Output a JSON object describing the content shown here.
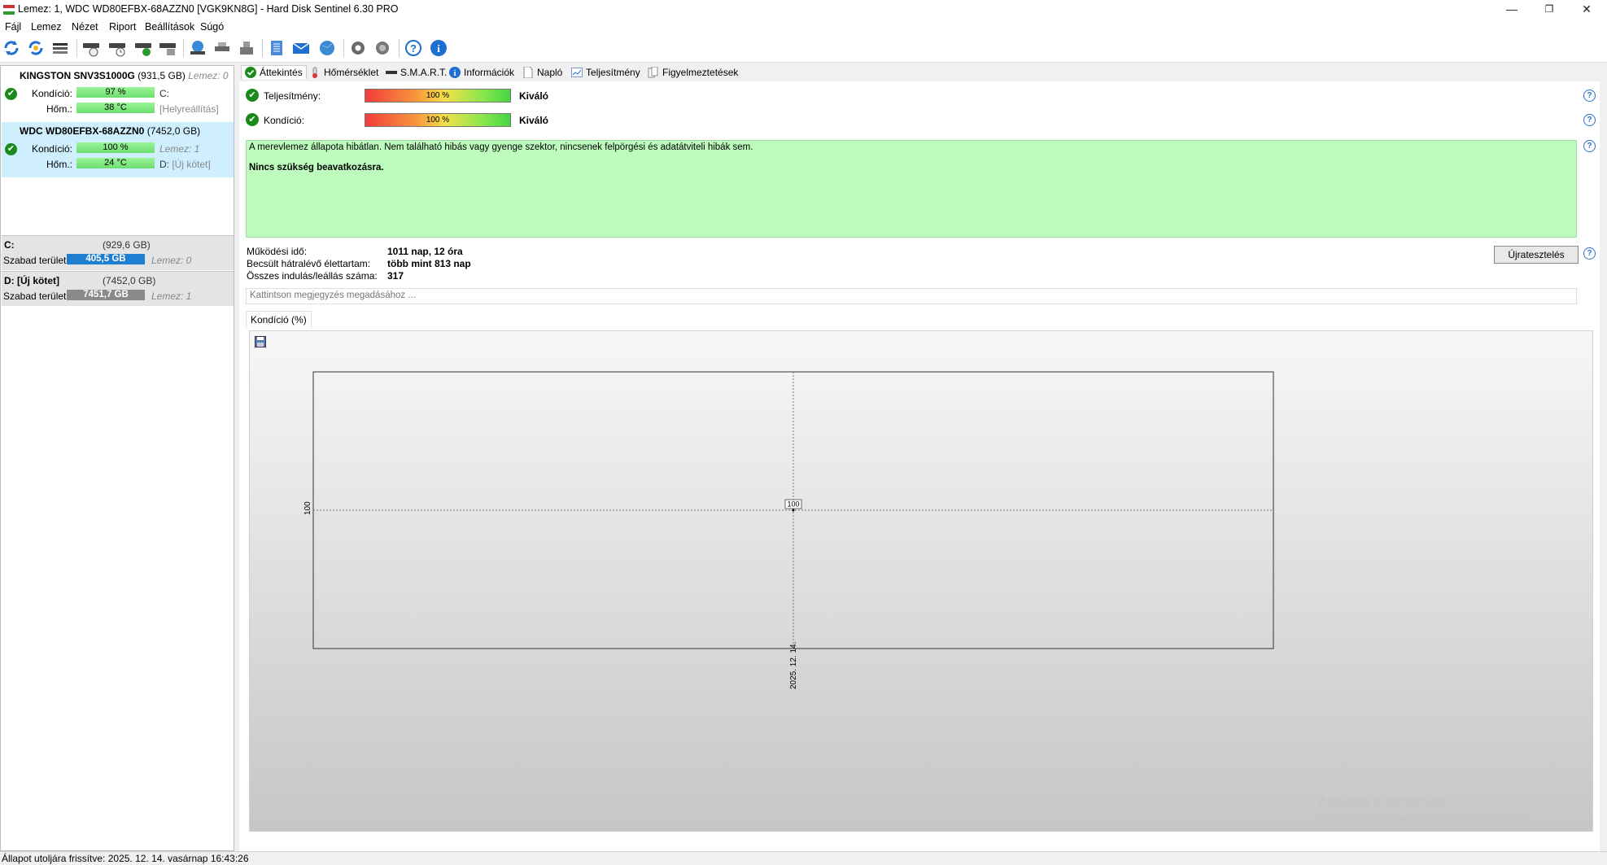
{
  "window": {
    "title": "Lemez: 1, WDC WD80EFBX-68AZZN0 [VGK9KN8G]  -  Hard Disk Sentinel 6.30 PRO",
    "minimize": "—",
    "maximize": "❐",
    "close": "✕"
  },
  "menu": [
    "Fájl",
    "Lemez",
    "Nézet",
    "Riport",
    "Beállítások",
    "Súgó"
  ],
  "disks": [
    {
      "name": "KINGSTON SNV3S1000G",
      "size": "(931,5 GB)",
      "disk_num": "Lemez: 0",
      "health_label": "Kondíció:",
      "health": "97 %",
      "health_extra": "C:",
      "temp_label": "Hőm.:",
      "temp": "38 °C",
      "temp_extra": "[Helyreállítás]"
    },
    {
      "name": "WDC WD80EFBX-68AZZN0",
      "size": "(7452,0 GB)",
      "disk_num": "",
      "health_label": "Kondíció:",
      "health": "100 %",
      "health_extra": "Lemez: 1",
      "temp_label": "Hőm.:",
      "temp": "24 °C",
      "temp_extra_a": "D:",
      "temp_extra_b": "[Új kötet]"
    }
  ],
  "volumes": [
    {
      "name": "C:",
      "size": "(929,6 GB)",
      "free_label": "Szabad terület",
      "free": "405,5 GB",
      "disk": "Lemez: 0",
      "bar_color": "#1e7fd0"
    },
    {
      "name": "D: [Új kötet]",
      "size": "(7452,0 GB)",
      "free_label": "Szabad terület",
      "free": "7451,7 GB",
      "disk": "Lemez: 1",
      "bar_color": "#8a8a8a"
    }
  ],
  "tabs": [
    "Áttekintés",
    "Hőmérséklet",
    "S.M.A.R.T.",
    "Információk",
    "Napló",
    "Teljesítmény",
    "Figyelmeztetések"
  ],
  "overview": {
    "performance_label": "Teljesítmény:",
    "performance_value": "100 %",
    "performance_word": "Kiváló",
    "health_label": "Kondíció:",
    "health_value": "100 %",
    "health_word": "Kiváló",
    "message_line1": "A merevlemez állapota hibátlan. Nem található hibás vagy gyenge szektor, nincsenek felpörgési és adatátviteli hibák sem.",
    "message_line2": "Nincs szükség beavatkozásra.",
    "uptime_label": "Működési idő:",
    "uptime": "1011 nap, 12 óra",
    "lifetime_label": "Becsült hátralévő élettartam:",
    "lifetime": "több mint 813 nap",
    "starts_label": "Összes indulás/leállás száma:",
    "starts": "317",
    "retest_button": "Újratesztelés",
    "note_placeholder": "Kattintson megjegyzés megadásához ..."
  },
  "chart_tab": "Kondíció  (%)",
  "chart_data": {
    "type": "line",
    "x": [
      "2025. 12. 14."
    ],
    "series": [
      {
        "values": [
          100
        ]
      }
    ],
    "y_tick_labels": [
      "100"
    ],
    "data_labels": [
      "100"
    ],
    "grid": true
  },
  "watermark": {
    "line1": "Aktiválja a Windowst",
    "line2": "Aktiválja a Windows rendszert a Gépházban."
  },
  "status": "Állapot utoljára frissítve: 2025. 12. 14. vasárnap 16:43:26",
  "help_glyph": "?",
  "ok_glyph": "✔"
}
